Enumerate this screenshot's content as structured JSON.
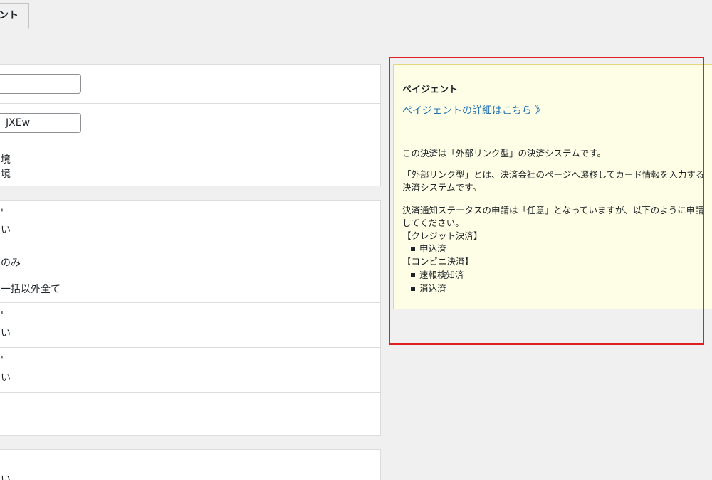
{
  "tabs": {
    "active_label": "ント"
  },
  "settings": {
    "card1": {
      "field1_value": "",
      "field2_value": "JXEw",
      "row3_line1": "境",
      "row3_line2": "境"
    },
    "card2": {
      "row1_line1": "'",
      "row1_line2": "い",
      "row2_line1": "のみ",
      "row2_line2": "一括以外全て",
      "row3_line1": "'",
      "row3_line2": "い",
      "row4_line1": "'",
      "row4_line2": "い"
    },
    "card3": {
      "row1_line2": "い"
    }
  },
  "info_panel": {
    "title": "ペイジェント",
    "link": "ペイジェントの詳細はこちら 》",
    "para1": "この決済は「外部リンク型」の決済システムです。",
    "para2": "「外部リンク型」とは、決済会社のページへ遷移してカード情報を入力する決済システムです。",
    "para3": "決済通知ステータスの申請は「任意」となっていますが、以下のように申請してください。",
    "credit_heading": "【クレジット決済】",
    "credit_items": [
      "申込済"
    ],
    "conveni_heading": "【コンビニ決済】",
    "conveni_items": [
      "速報検知済",
      "消込済"
    ]
  },
  "colors": {
    "highlight": "#e02020",
    "link": "#2271b1",
    "info_bg": "#fefee6"
  }
}
